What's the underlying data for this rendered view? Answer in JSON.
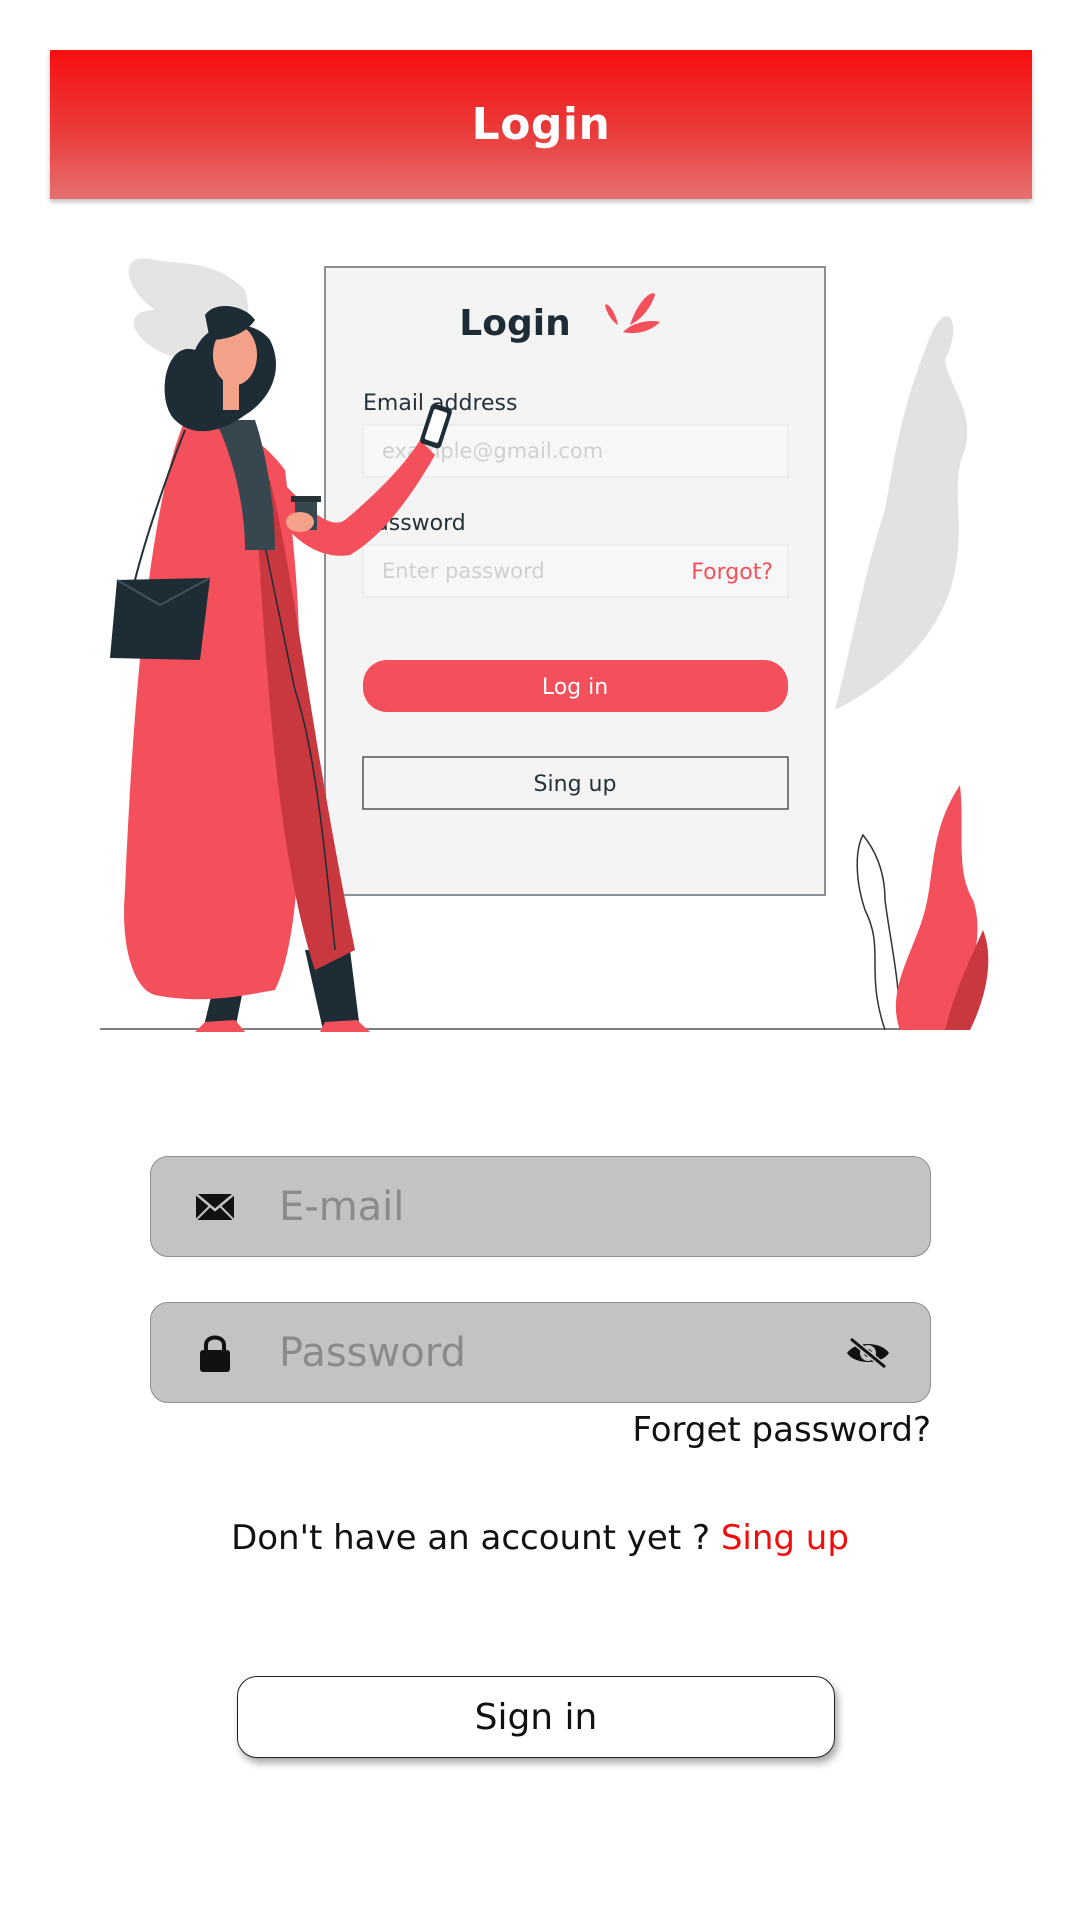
{
  "header": {
    "title": "Login"
  },
  "illustration": {
    "card_title": "Login",
    "email_label": "Email address",
    "email_placeholder": "example@gmail.com",
    "password_label": "Password",
    "password_placeholder": "Enter password",
    "forgot_label": "Forgot?",
    "login_button": "Log in",
    "signup_button": "Sing up",
    "colors": {
      "accent": "#f4505c",
      "dark": "#1e2d35",
      "leaf": "#e1e1e1"
    }
  },
  "form": {
    "email": {
      "placeholder": "E-mail",
      "icon": "envelope-icon"
    },
    "password": {
      "placeholder": "Password",
      "icon": "lock-icon",
      "toggle_icon": "eye-off-icon"
    },
    "forget_password": "Forget password?",
    "no_account_text": "Don't have an account yet ? ",
    "signup_link": "Sing up",
    "signin_button": "Sign in"
  },
  "colors": {
    "header_red": "#f90f0f",
    "link_red": "#f20d0d",
    "field_bg": "#c3c3c3"
  }
}
